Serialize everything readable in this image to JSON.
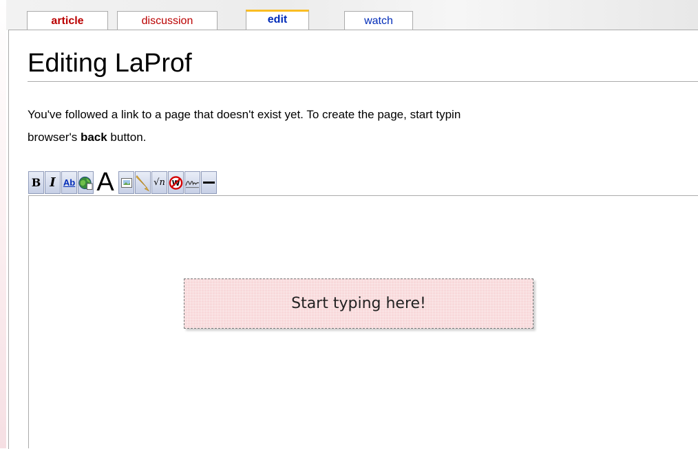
{
  "tabs": {
    "article": "article",
    "discussion": "discussion",
    "edit": "edit",
    "watch": "watch"
  },
  "page": {
    "title": "Editing LaProf",
    "notice_part1": "You've followed a link to a page that doesn't exist yet. To create the page, start typin",
    "notice_part2": "browser's ",
    "notice_bold": "back",
    "notice_part3": " button."
  },
  "toolbar": {
    "bold": "B",
    "italic": "I",
    "link": "Ab",
    "headline": "A",
    "math": "√n"
  },
  "editor": {
    "hint": "Start typing here!"
  },
  "colors": {
    "tab_accent": "#fabd23",
    "link_red": "#ba0000",
    "link_blue": "#002bb8",
    "hint_bg": "#f8d9db"
  }
}
